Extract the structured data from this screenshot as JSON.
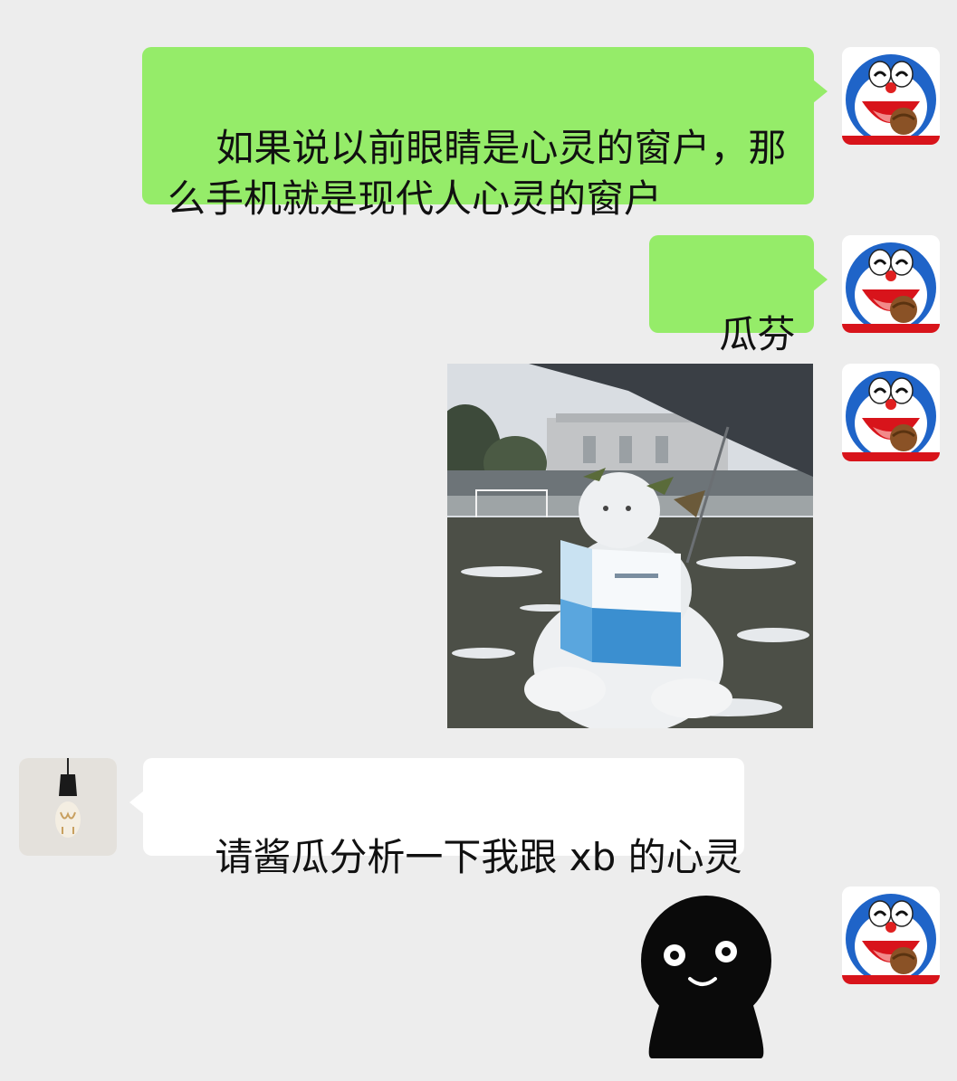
{
  "messages": [
    {
      "id": "m1",
      "direction": "outgoing",
      "type": "text",
      "text": "如果说以前眼睛是心灵的窗户，那\n么手机就是现代人心灵的窗户",
      "avatar_icon": "doraemon-icon"
    },
    {
      "id": "m2",
      "direction": "outgoing",
      "type": "text",
      "text": "瓜芬奇",
      "avatar_icon": "doraemon-icon"
    },
    {
      "id": "m3",
      "direction": "outgoing",
      "type": "image",
      "image": "snowman-reading-book-photo",
      "avatar_icon": "doraemon-icon"
    },
    {
      "id": "m4",
      "direction": "incoming",
      "type": "text",
      "text": "请酱瓜分析一下我跟 xb 的心灵",
      "avatar_icon": "lamp-icon"
    },
    {
      "id": "m5",
      "direction": "outgoing",
      "type": "sticker",
      "sticker": "black-blob-smiling-sticker",
      "avatar_icon": "doraemon-icon"
    }
  ],
  "colors": {
    "background": "#ededed",
    "outgoing_bubble": "#95ec69",
    "incoming_bubble": "#ffffff",
    "text": "#111111"
  }
}
